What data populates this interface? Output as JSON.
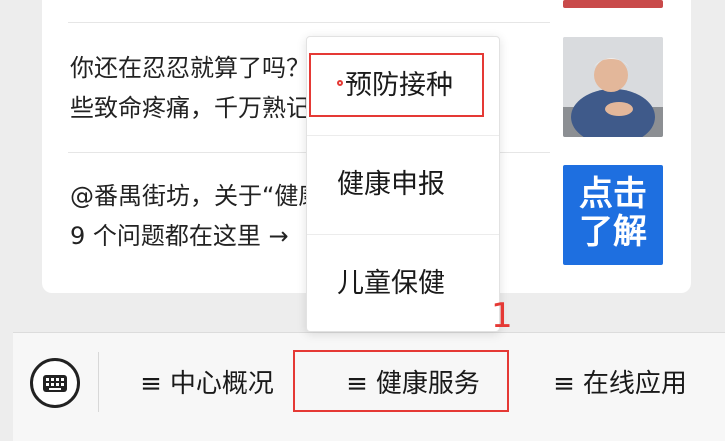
{
  "articles": [
    {
      "title_line1": "你还在忍忍就算了吗？这",
      "title_line2": "些致命疼痛，千万熟记！",
      "thumb_icon": "chest-pain-photo"
    },
    {
      "title_line1": "@番禺街坊，关于“健康码”的",
      "title_line2": "9 个问题都在这里 →",
      "thumb_text_line1": "点击",
      "thumb_text_line2": "了解"
    }
  ],
  "submenu": {
    "items": [
      {
        "label": "预防接种"
      },
      {
        "label": "健康申报"
      },
      {
        "label": "儿童保健"
      }
    ]
  },
  "menu_bar": {
    "keyboard_icon": "keyboard-icon",
    "items": [
      {
        "label": "中心概况",
        "icon": "≡"
      },
      {
        "label": "健康服务",
        "icon": "≡"
      },
      {
        "label": "在线应用",
        "icon": "≡"
      }
    ]
  },
  "annotation": {
    "label": "1"
  },
  "colors": {
    "highlight": "#e53935",
    "thumb_blue": "#1e6fe0"
  }
}
